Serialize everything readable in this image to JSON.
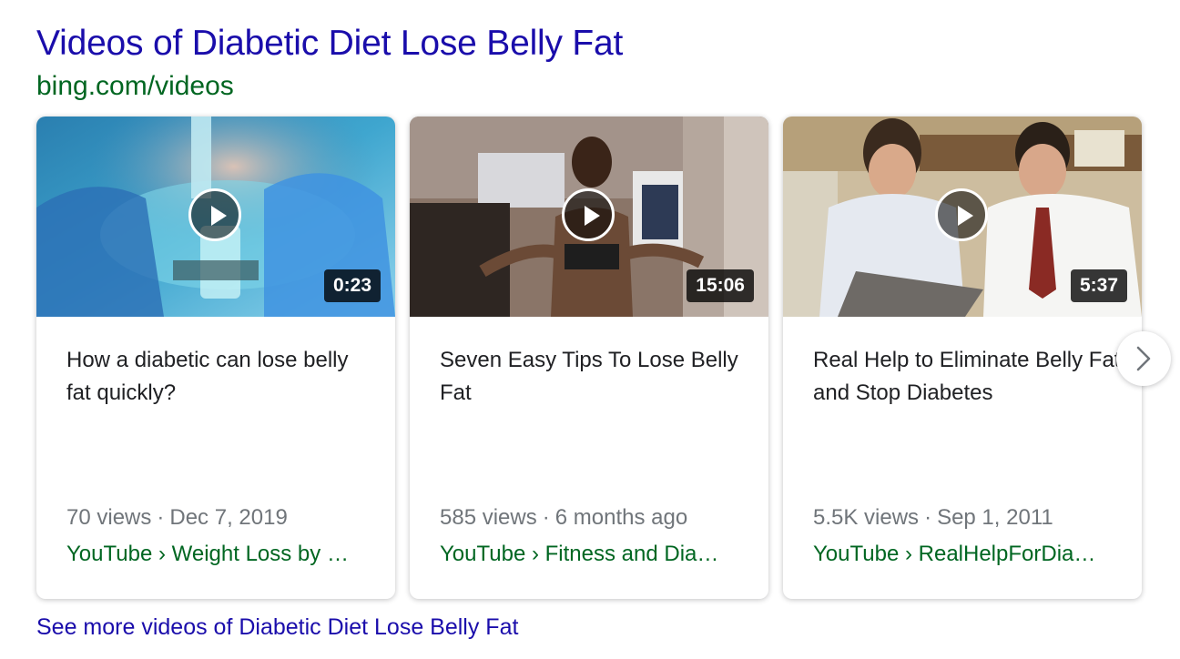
{
  "header": {
    "title": "Videos of Diabetic Diet Lose Belly Fat",
    "source": "bing.com/videos"
  },
  "videos": [
    {
      "duration": "0:23",
      "title": "How a diabetic can lose belly fat quickly?",
      "views": "70 views",
      "date": "Dec 7, 2019",
      "breadcrumb": "YouTube › Weight Loss by …"
    },
    {
      "duration": "15:06",
      "title": "Seven Easy Tips To Lose Belly Fat",
      "views": "585 views",
      "date": "6 months ago",
      "breadcrumb": "YouTube › Fitness and Dia…"
    },
    {
      "duration": "5:37",
      "title": "Real Help to Eliminate Belly Fat and Stop Diabetes",
      "views": "5.5K views",
      "date": "Sep 1, 2011",
      "breadcrumb": "YouTube › RealHelpForDia…"
    }
  ],
  "meta_separator": "·",
  "footer": {
    "see_more": "See more videos of Diabetic Diet Lose Belly Fat"
  },
  "icons": {
    "play": "play-icon",
    "next": "chevron-right-icon"
  },
  "colors": {
    "link": "#1a0dab",
    "url_green": "#006621",
    "meta_gray": "#70757a"
  }
}
